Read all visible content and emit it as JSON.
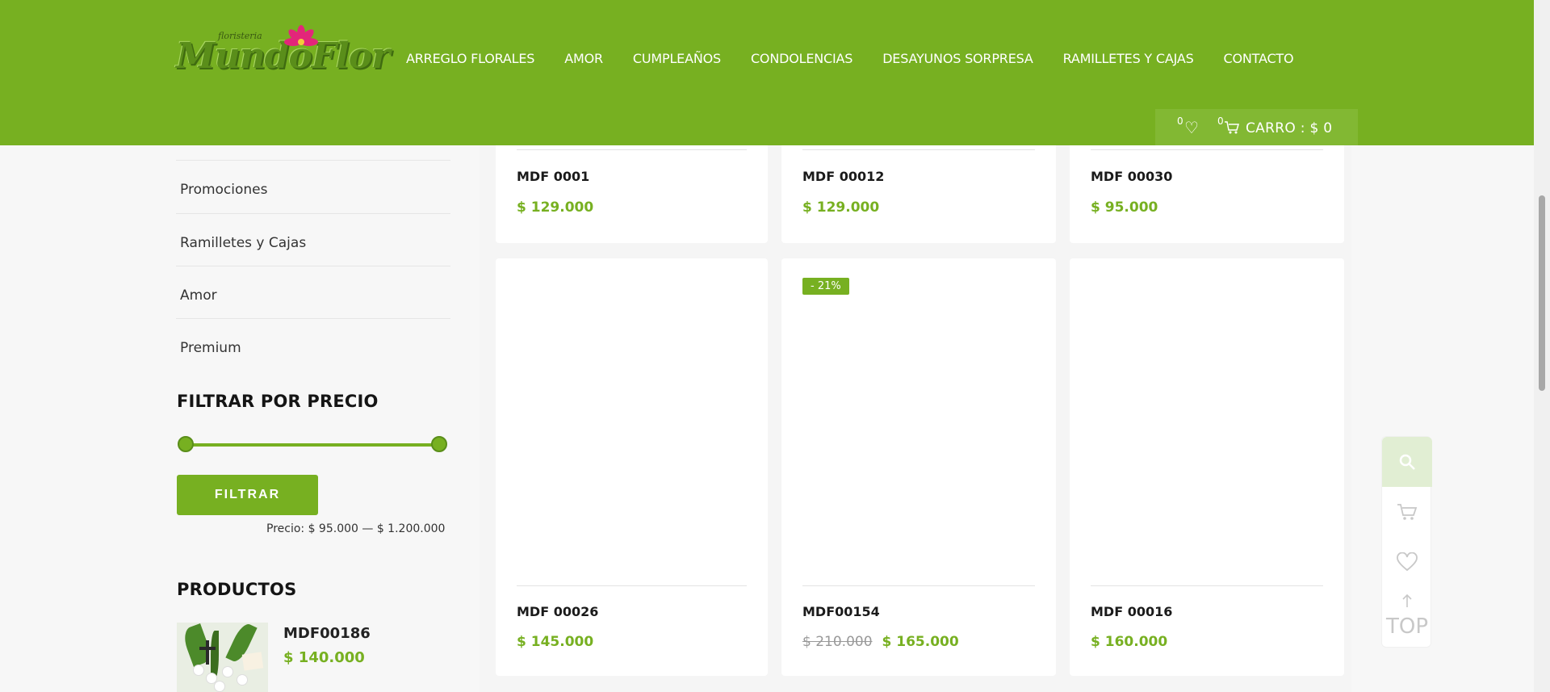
{
  "header": {
    "logo_small": "floristeria",
    "logo_text": "MundoFlor",
    "nav": [
      "ARREGLO FLORALES",
      "AMOR",
      "CUMPLEAÑOS",
      "CONDOLENCIAS",
      "DESAYUNOS SORPRESA",
      "RAMILLETES Y CAJAS",
      "CONTACTO"
    ],
    "wishlist_count": "0",
    "cart_count": "0",
    "cart_label": "CARRO : $ 0"
  },
  "sidebar": {
    "categories": [
      "Promociones",
      "Ramilletes y Cajas",
      "Amor",
      "Premium"
    ],
    "filter_title": "FILTRAR POR PRECIO",
    "filter_button": "FILTRAR",
    "price_range": "Precio: $ 95.000 — $ 1.200.000",
    "products_title": "PRODUCTOS",
    "product": {
      "name": "MDF00186",
      "price": "$ 140.000"
    }
  },
  "products": [
    {
      "name": "MDF 0001",
      "price": "$ 129.000"
    },
    {
      "name": "MDF 00012",
      "price": "$ 129.000"
    },
    {
      "name": "MDF 00030",
      "price": "$ 95.000"
    },
    {
      "name": "MDF 00026",
      "price": "$ 145.000"
    },
    {
      "name": "MDF00154",
      "old_price": "$ 210.000",
      "price": "$ 165.000",
      "badge": "- 21%"
    },
    {
      "name": "MDF 00016",
      "price": "$ 160.000"
    }
  ],
  "tools": {
    "top_label": "TOP"
  },
  "colors": {
    "brand_green": "#77b021",
    "text_dark": "#1a1a1a"
  }
}
